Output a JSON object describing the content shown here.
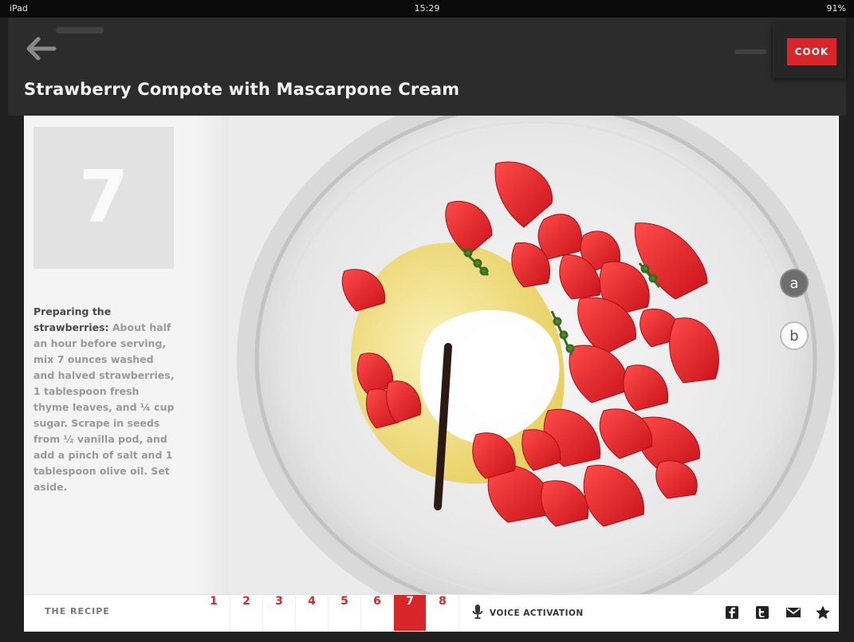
{
  "status_bar": {
    "carrier": "iPad",
    "time": "15:29",
    "battery": "91%"
  },
  "header": {
    "cook_label": "COOK",
    "title": "Strawberry Compote with Mascarpone Cream"
  },
  "step": {
    "number": "7",
    "heading": "Preparing the strawberries:",
    "text": " About half an hour before serving, mix 7 ounces washed and halved strawberries, 1 tablespoon fresh thyme leaves, and ¼ cup sugar. Scrape in seeds from ½ vanilla pod, and add a pinch of salt and 1 tablespoon olive oil. Set aside."
  },
  "markers": {
    "a": "a",
    "b": "b"
  },
  "footer": {
    "recipe_tab": "THE RECIPE",
    "steps": [
      "1",
      "2",
      "3",
      "4",
      "5",
      "6",
      "7",
      "8"
    ],
    "active_step": "7",
    "voice_label": "VOICE ACTIVATION"
  },
  "colors": {
    "accent": "#d8262b",
    "header_bg": "#2c2c2c"
  },
  "icons": [
    "back-arrow-icon",
    "microphone-icon",
    "facebook-icon",
    "twitter-icon",
    "mail-icon",
    "star-icon"
  ]
}
